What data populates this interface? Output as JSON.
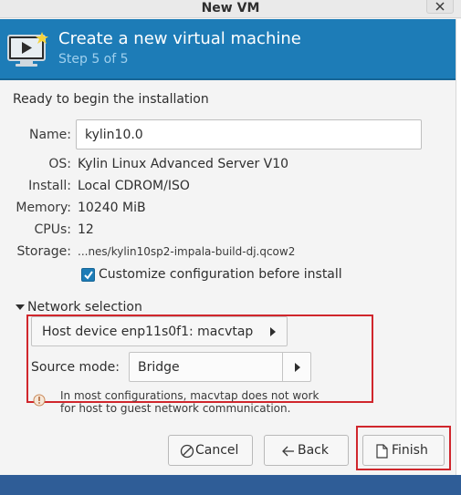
{
  "window": {
    "title": "New VM"
  },
  "header": {
    "heading": "Create a new virtual machine",
    "step": "Step 5 of 5",
    "icon": "virtual-machine-icon"
  },
  "summary": {
    "ready_text": "Ready to begin the installation",
    "name_label": "Name:",
    "name_value": "kylin10.0",
    "os_label": "OS:",
    "os_value": "Kylin Linux Advanced Server V10",
    "install_label": "Install:",
    "install_value": "Local CDROM/ISO",
    "memory_label": "Memory:",
    "memory_value": "10240 MiB",
    "cpus_label": "CPUs:",
    "cpus_value": "12",
    "storage_label": "Storage:",
    "storage_value": "...nes/kylin10sp2-impala-build-dj.qcow2",
    "customize_label": "Customize configuration before install",
    "customize_checked": true
  },
  "network": {
    "section_label": "Network selection",
    "expanded": true,
    "host_device": "Host device enp11s0f1: macvtap",
    "source_mode_label": "Source mode:",
    "source_mode_value": "Bridge",
    "info_line1": "In most configurations, macvtap does not work",
    "info_line2": "for host to guest network communication."
  },
  "buttons": {
    "cancel": "Cancel",
    "back": "Back",
    "finish": "Finish"
  },
  "colors": {
    "banner": "#1d7cb7",
    "highlight": "#d0262c"
  }
}
